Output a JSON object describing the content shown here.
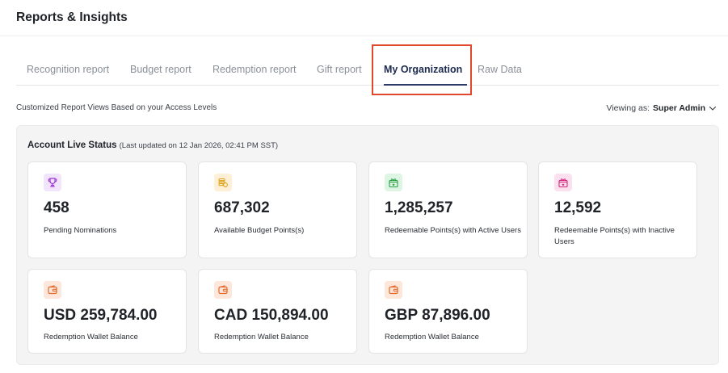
{
  "header": {
    "title": "Reports & Insights"
  },
  "tabs": [
    {
      "label": "Recognition report"
    },
    {
      "label": "Budget report"
    },
    {
      "label": "Redemption report"
    },
    {
      "label": "Gift report"
    },
    {
      "label": "My Organization",
      "active": true
    },
    {
      "label": "Raw Data"
    }
  ],
  "subheader": {
    "description": "Customized Report Views Based on your Access Levels",
    "viewing_prefix": "Viewing as:",
    "viewing_role": "Super Admin"
  },
  "status": {
    "title": "Account Live Status",
    "updated": "(Last updated on 12 Jan 2026, 02:41 PM SST)"
  },
  "cards": [
    {
      "value": "458",
      "label": "Pending Nominations",
      "icon": "trophy-icon",
      "icon_bg": "#f1e4fb",
      "icon_color": "#9b38d6"
    },
    {
      "value": "687,302",
      "label": "Available Budget Points(s)",
      "icon": "coins-icon",
      "icon_bg": "#fdf0d6",
      "icon_color": "#e0a21c"
    },
    {
      "value": "1,285,257",
      "label": "Redeemable Points(s) with Active Users",
      "icon": "gift-icon",
      "icon_bg": "#def5e3",
      "icon_color": "#2aa046"
    },
    {
      "value": "12,592",
      "label": "Redeemable Points(s) with Inactive Users",
      "icon": "gift-icon",
      "icon_bg": "#fbe1ef",
      "icon_color": "#d3287e"
    },
    {
      "value": "USD 259,784.00",
      "label": "Redemption Wallet Balance",
      "icon": "wallet-icon",
      "icon_bg": "#fde6da",
      "icon_color": "#e4692a"
    },
    {
      "value": "CAD 150,894.00",
      "label": "Redemption Wallet Balance",
      "icon": "wallet-icon",
      "icon_bg": "#fde6da",
      "icon_color": "#e4692a"
    },
    {
      "value": "GBP 87,896.00",
      "label": "Redemption Wallet Balance",
      "icon": "wallet-icon",
      "icon_bg": "#fde6da",
      "icon_color": "#e4692a"
    }
  ],
  "colors": {
    "accent": "#2b3a66",
    "highlight": "#e0472c"
  }
}
